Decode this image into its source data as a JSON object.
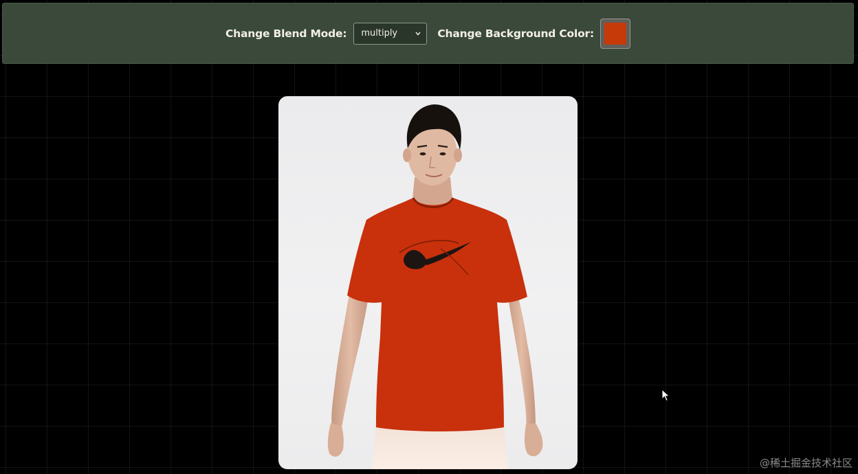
{
  "toolbar": {
    "blend_label": "Change Blend Mode:",
    "blend_value": "multiply",
    "bg_label": "Change Background Color:",
    "bg_color": "#c63a0a"
  },
  "preview": {
    "shirt_color": "#c9300c"
  },
  "watermark": "@稀土掘金技术社区"
}
